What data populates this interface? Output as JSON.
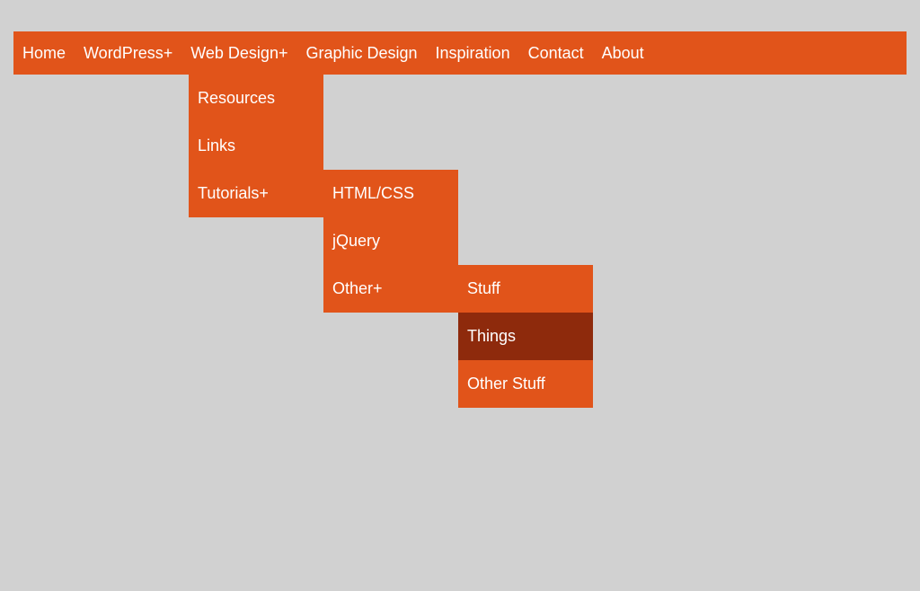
{
  "navbar": {
    "items": [
      {
        "label": "Home",
        "hasSubmenu": false
      },
      {
        "label": "WordPress",
        "hasSubmenu": true
      },
      {
        "label": "Web Design",
        "hasSubmenu": true
      },
      {
        "label": "Graphic Design",
        "hasSubmenu": false
      },
      {
        "label": "Inspiration",
        "hasSubmenu": false
      },
      {
        "label": "Contact",
        "hasSubmenu": false
      },
      {
        "label": "About",
        "hasSubmenu": false
      }
    ]
  },
  "dropdownLevel1": {
    "items": [
      {
        "label": "Resources",
        "hasSubmenu": false
      },
      {
        "label": "Links",
        "hasSubmenu": false
      },
      {
        "label": "Tutorials",
        "hasSubmenu": true
      }
    ]
  },
  "dropdownLevel2": {
    "items": [
      {
        "label": "HTML/CSS",
        "hasSubmenu": false
      },
      {
        "label": "jQuery",
        "hasSubmenu": false
      },
      {
        "label": "Other",
        "hasSubmenu": true
      }
    ]
  },
  "dropdownLevel3": {
    "items": [
      {
        "label": "Stuff",
        "hasSubmenu": false,
        "hovered": false
      },
      {
        "label": "Things",
        "hasSubmenu": false,
        "hovered": true
      },
      {
        "label": "Other Stuff",
        "hasSubmenu": false,
        "hovered": false
      }
    ]
  }
}
